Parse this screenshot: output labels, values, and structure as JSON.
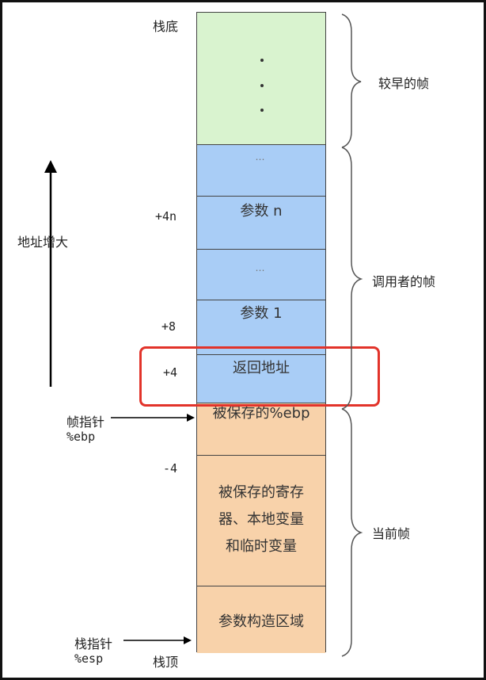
{
  "stack": {
    "bottom_label": "栈底",
    "top_label": "栈顶",
    "cells": [
      {
        "name": "earlier-frame-cell",
        "text": "",
        "dots": "vertical",
        "color": "green"
      },
      {
        "name": "ellipsis-cell-1",
        "text": "…",
        "color": "blue"
      },
      {
        "name": "param-n-cell",
        "text": "参数 n",
        "color": "blue"
      },
      {
        "name": "ellipsis-cell-2",
        "text": "…",
        "color": "blue"
      },
      {
        "name": "param-1-cell",
        "text": "参数 1",
        "color": "blue"
      },
      {
        "name": "return-address-cell",
        "text": "返回地址",
        "color": "blue"
      },
      {
        "name": "saved-ebp-cell",
        "text": "被保存的%ebp",
        "color": "orange"
      },
      {
        "name": "saved-registers-cell",
        "text": "被保存的寄存\n器、本地变量\n和临时变量",
        "color": "orange"
      },
      {
        "name": "param-build-area-cell",
        "text": "参数构造区域",
        "color": "orange"
      }
    ]
  },
  "offsets": {
    "plus_4n": "+4n",
    "plus_8": "+8",
    "plus_4": "+4",
    "minus_4": "-4"
  },
  "left": {
    "address_growth": "地址增大",
    "frame_pointer": "帧指针",
    "ebp": "%ebp",
    "stack_pointer": "栈指针",
    "esp": "%esp"
  },
  "braces": {
    "earlier_frame": "较早的帧",
    "caller_frame": "调用者的帧",
    "current_frame": "当前帧"
  },
  "colors": {
    "green": "#d9f3cf",
    "blue": "#a9cdf6",
    "orange": "#f8d2aa",
    "highlight": "#e2332a"
  }
}
